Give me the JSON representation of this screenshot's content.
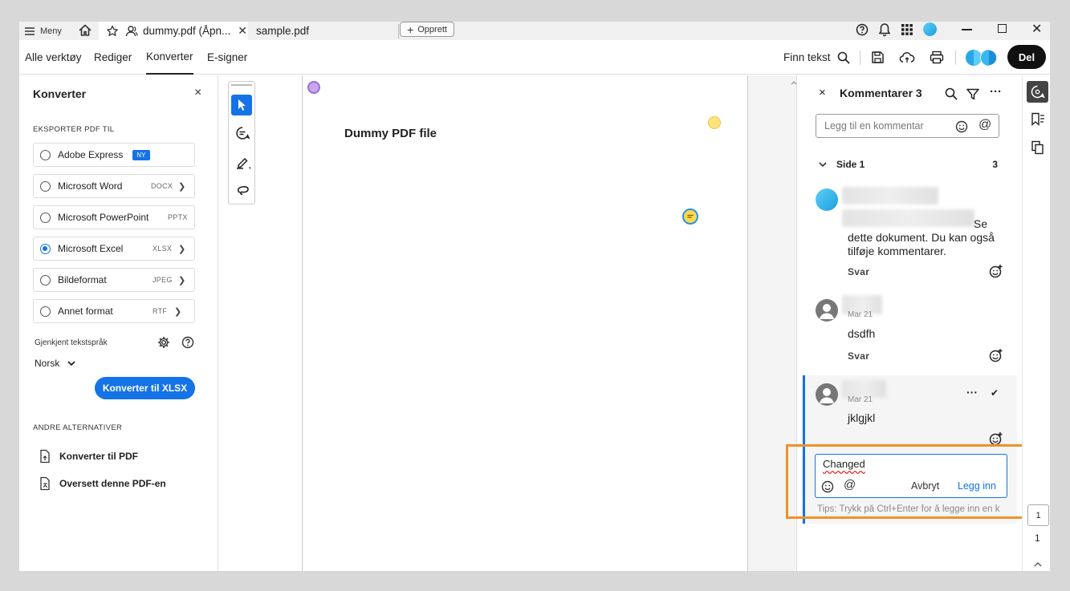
{
  "titlebar": {
    "menu_label": "Meny",
    "tabs": [
      {
        "label": "dummy.pdf (Åpn..."
      },
      {
        "label": "sample.pdf"
      }
    ],
    "create_label": "Opprett"
  },
  "toolbar": {
    "nav": [
      "Alle verktøy",
      "Rediger",
      "Konverter",
      "E-signer"
    ],
    "find_text": "Finn tekst",
    "share_label": "Del"
  },
  "left_panel": {
    "title": "Konverter",
    "export_heading": "EKSPORTER PDF TIL",
    "options": [
      {
        "label": "Adobe Express",
        "badge": "NY",
        "selected": false
      },
      {
        "label": "Microsoft Word",
        "format": "DOCX",
        "selected": false
      },
      {
        "label": "Microsoft PowerPoint",
        "format": "PPTX",
        "selected": false
      },
      {
        "label": "Microsoft Excel",
        "format": "XLSX",
        "selected": true
      },
      {
        "label": "Bildeformat",
        "format": "JPEG",
        "selected": false
      },
      {
        "label": "Annet format",
        "format": "RTF",
        "selected": false
      }
    ],
    "language_label": "Gjenkjent tekstspråk",
    "language_value": "Norsk",
    "convert_button": "Konverter til XLSX",
    "other_heading": "ANDRE ALTERNATIVER",
    "other_options": [
      "Konverter til PDF",
      "Oversett denne PDF-en"
    ]
  },
  "document": {
    "title": "Dummy PDF file"
  },
  "comments_panel": {
    "title": "Kommentarer 3",
    "input_placeholder": "Legg til en kommentar",
    "page_label": "Side 1",
    "page_count": "3",
    "comments": [
      {
        "text_visible": "Se",
        "text_line2": "dette dokument. Du kan også",
        "text_line3": "tilføje kommentarer.",
        "reply": "Svar"
      },
      {
        "date": "Mar 21",
        "text": "dsdfh",
        "reply": "Svar"
      },
      {
        "date": "Mar 21",
        "text": "jklgjkl"
      }
    ],
    "edit": {
      "value": "Changed",
      "cancel": "Avbryt",
      "submit": "Legg inn"
    },
    "tips": "Tips: Trykk på Ctrl+Enter for å legge inn en k"
  },
  "page_nav": {
    "current": "1",
    "total": "1"
  },
  "colors": {
    "accent": "#1473e6",
    "highlight": "#f0912a"
  }
}
